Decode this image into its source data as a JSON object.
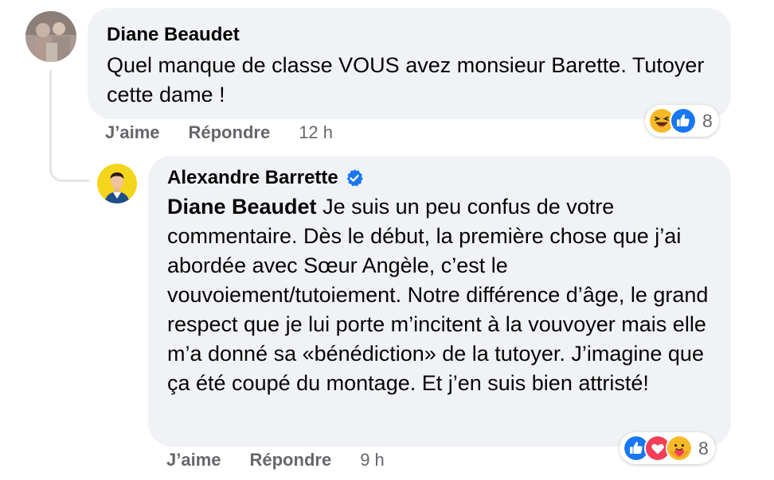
{
  "comments": [
    {
      "author": "Diane Beaudet",
      "text": "Quel manque de classe VOUS avez monsieur Barette. Tutoyer cette dame !",
      "actions": {
        "like": "J’aime",
        "reply": "Répondre",
        "time": "12 h"
      },
      "reactions": {
        "icons": [
          "haha-icon",
          "like-icon"
        ],
        "count": "8"
      }
    },
    {
      "author": "Alexandre Barrette",
      "verified": true,
      "mention": "Diane Beaudet",
      "text": " Je suis un peu confus de votre commentaire. Dès le début, la première chose que j’ai abordée avec Sœur Angèle, c’est le vouvoiement/tutoiement. Notre différence d’âge, le grand respect que je lui porte m’incitent à la vouvoyer mais elle m’a donné sa «bénédiction» de la tutoyer. J’imagine que ça été coupé du montage. Et j’en suis bien attristé!",
      "actions": {
        "like": "J’aime",
        "reply": "Répondre",
        "time": "9 h"
      },
      "reactions": {
        "icons": [
          "like-icon",
          "love-icon",
          "care-icon"
        ],
        "count": "8"
      }
    }
  ],
  "colors": {
    "bubble": "#f0f2f5",
    "secondary_text": "#65676b",
    "like_blue": "#1877f2",
    "love_red": "#f33e58",
    "reaction_yellow": "#f7b928"
  }
}
